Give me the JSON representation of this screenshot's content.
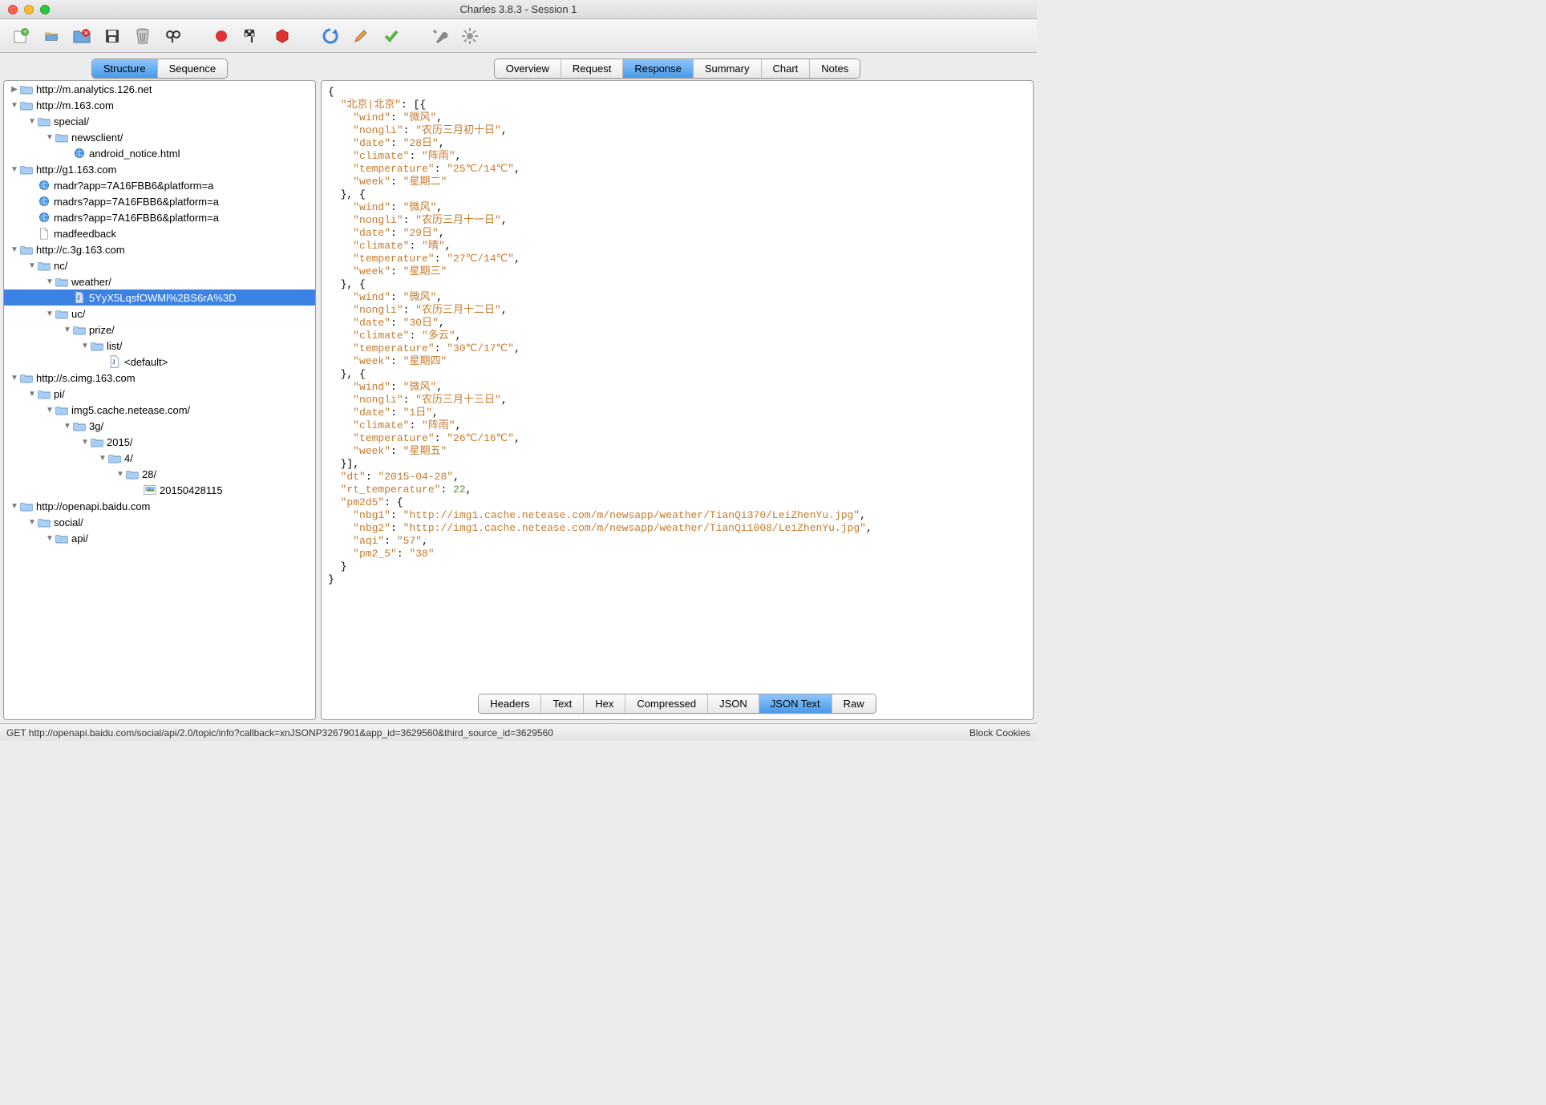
{
  "window": {
    "title": "Charles 3.8.3 - Session 1"
  },
  "toolbar_icons": [
    "new",
    "open",
    "close",
    "save",
    "trash",
    "find",
    "record",
    "stop-flag",
    "stop",
    "refresh",
    "edit",
    "accept",
    "tools",
    "settings"
  ],
  "left_tabs": [
    "Structure",
    "Sequence"
  ],
  "left_tab_active": 0,
  "right_tabs": [
    "Overview",
    "Request",
    "Response",
    "Summary",
    "Chart",
    "Notes"
  ],
  "right_tab_active": 2,
  "bottom_tabs": [
    "Headers",
    "Text",
    "Hex",
    "Compressed",
    "JSON",
    "JSON Text",
    "Raw"
  ],
  "bottom_tab_active": 5,
  "tree": [
    {
      "d": 0,
      "tw": "▶",
      "ic": "folder",
      "t": "http://m.analytics.126.net"
    },
    {
      "d": 0,
      "tw": "▼",
      "ic": "folder",
      "t": "http://m.163.com"
    },
    {
      "d": 1,
      "tw": "▼",
      "ic": "folder",
      "t": "special/"
    },
    {
      "d": 2,
      "tw": "▼",
      "ic": "folder",
      "t": "newsclient/"
    },
    {
      "d": 3,
      "tw": "",
      "ic": "world",
      "t": "android_notice.html"
    },
    {
      "d": 0,
      "tw": "▼",
      "ic": "folder",
      "t": "http://g1.163.com"
    },
    {
      "d": 1,
      "tw": "",
      "ic": "world",
      "t": "madr?app=7A16FBB6&platform=a"
    },
    {
      "d": 1,
      "tw": "",
      "ic": "world",
      "t": "madrs?app=7A16FBB6&platform=a"
    },
    {
      "d": 1,
      "tw": "",
      "ic": "world",
      "t": "madrs?app=7A16FBB6&platform=a"
    },
    {
      "d": 1,
      "tw": "",
      "ic": "file",
      "t": "madfeedback"
    },
    {
      "d": 0,
      "tw": "▼",
      "ic": "folder",
      "t": "http://c.3g.163.com"
    },
    {
      "d": 1,
      "tw": "▼",
      "ic": "folder",
      "t": "nc/"
    },
    {
      "d": 2,
      "tw": "▼",
      "ic": "folder",
      "t": "weather/"
    },
    {
      "d": 3,
      "tw": "",
      "ic": "json",
      "t": "5YyX5LqsfOWMl%2BS6rA%3D",
      "sel": true
    },
    {
      "d": 2,
      "tw": "▼",
      "ic": "folder",
      "t": "uc/"
    },
    {
      "d": 3,
      "tw": "▼",
      "ic": "folder",
      "t": "prize/"
    },
    {
      "d": 4,
      "tw": "▼",
      "ic": "folder",
      "t": "list/"
    },
    {
      "d": 5,
      "tw": "",
      "ic": "json",
      "t": "<default>"
    },
    {
      "d": 0,
      "tw": "▼",
      "ic": "folder",
      "t": "http://s.cimg.163.com"
    },
    {
      "d": 1,
      "tw": "▼",
      "ic": "folder",
      "t": "pi/"
    },
    {
      "d": 2,
      "tw": "▼",
      "ic": "folder",
      "t": "img5.cache.netease.com/"
    },
    {
      "d": 3,
      "tw": "▼",
      "ic": "folder",
      "t": "3g/"
    },
    {
      "d": 4,
      "tw": "▼",
      "ic": "folder",
      "t": "2015/"
    },
    {
      "d": 5,
      "tw": "▼",
      "ic": "folder",
      "t": "4/"
    },
    {
      "d": 6,
      "tw": "▼",
      "ic": "folder",
      "t": "28/"
    },
    {
      "d": 7,
      "tw": "",
      "ic": "img",
      "t": "20150428115"
    },
    {
      "d": 0,
      "tw": "▼",
      "ic": "folder",
      "t": "http://openapi.baidu.com"
    },
    {
      "d": 1,
      "tw": "▼",
      "ic": "folder",
      "t": "social/"
    },
    {
      "d": 2,
      "tw": "▼",
      "ic": "folder",
      "t": "api/"
    }
  ],
  "response_json": {
    "北京|北京": [
      {
        "wind": "微风",
        "nongli": "农历三月初十日",
        "date": "28日",
        "climate": "阵雨",
        "temperature": "25℃/14℃",
        "week": "星期二"
      },
      {
        "wind": "微风",
        "nongli": "农历三月十一日",
        "date": "29日",
        "climate": "晴",
        "temperature": "27℃/14℃",
        "week": "星期三"
      },
      {
        "wind": "微风",
        "nongli": "农历三月十二日",
        "date": "30日",
        "climate": "多云",
        "temperature": "30℃/17℃",
        "week": "星期四"
      },
      {
        "wind": "微风",
        "nongli": "农历三月十三日",
        "date": "1日",
        "climate": "阵雨",
        "temperature": "26℃/16℃",
        "week": "星期五"
      }
    ],
    "dt": "2015-04-28",
    "rt_temperature": 22,
    "pm2d5": {
      "nbg1": "http://img1.cache.netease.com/m/newsapp/weather/TianQi370/LeiZhenYu.jpg",
      "nbg2": "http://img1.cache.netease.com/m/newsapp/weather/TianQi1008/LeiZhenYu.jpg",
      "aqi": "57",
      "pm2_5": "38"
    }
  },
  "status": {
    "left": "GET http://openapi.baidu.com/social/api/2.0/topic/info?callback=xnJSONP3267901&app_id=3629560&third_source_id=3629560",
    "right": "Block Cookies"
  }
}
